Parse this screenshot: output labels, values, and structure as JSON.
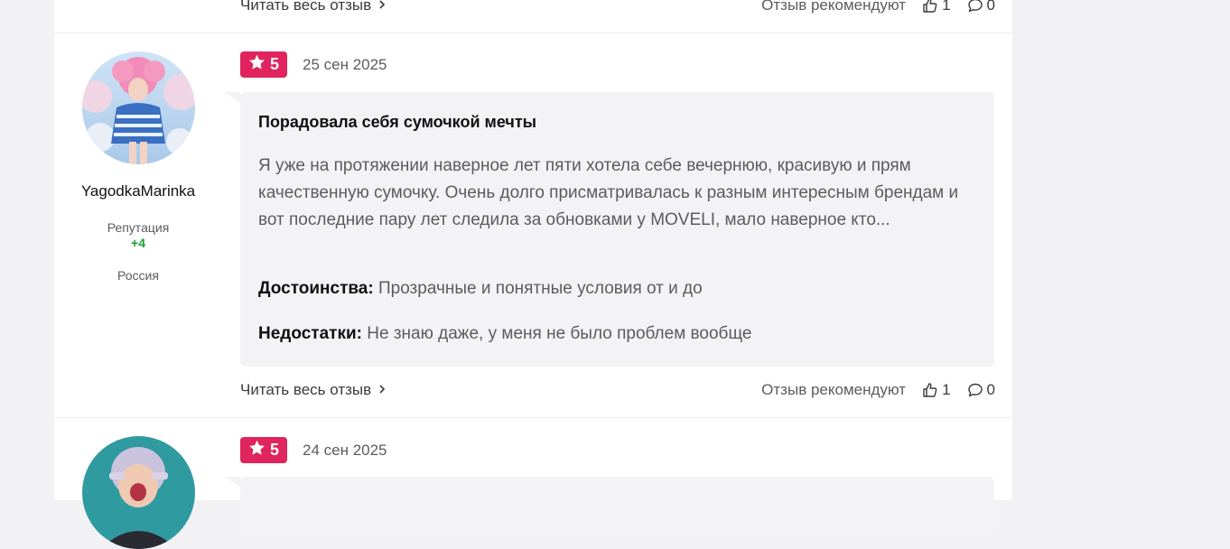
{
  "prev_review": {
    "read_more": "Читать весь отзыв",
    "recommend_text": "Отзыв рекомендуют",
    "likes": "1",
    "comments": "0"
  },
  "review": {
    "username": "YagodkaMarinka",
    "reputation_label": "Репутация",
    "reputation_value": "+4",
    "country": "Россия",
    "rating": "5",
    "date": "25 сен 2025",
    "title": "Порадовала себя сумочкой мечты",
    "text": "Я уже на протяжении наверное лет пяти хотела себе вечернюю, красивую и прям качественную сумочку. Очень долго присматривалась к разным интересным брендам и вот последние пару лет следила за обновками у MOVELI, мало наверное кто...",
    "pros_label": "Достоинства:",
    "pros_text": "Прозрачные и понятные условия от и до",
    "cons_label": "Недостатки:",
    "cons_text": "Не знаю даже, у меня не было проблем вообще",
    "read_more": "Читать весь отзыв",
    "recommend_text": "Отзыв рекомендуют",
    "likes": "1",
    "comments": "0"
  },
  "next_review": {
    "rating": "5",
    "date": "24 сен 2025"
  },
  "icons": {
    "star": "star-icon",
    "chevron": "chevron-right-icon",
    "like": "thumbs-up-icon",
    "comment": "comment-icon"
  },
  "colors": {
    "rating_badge": "#e0245e",
    "reputation_positive": "#1aa336",
    "bubble_bg": "#f3f3f5"
  }
}
